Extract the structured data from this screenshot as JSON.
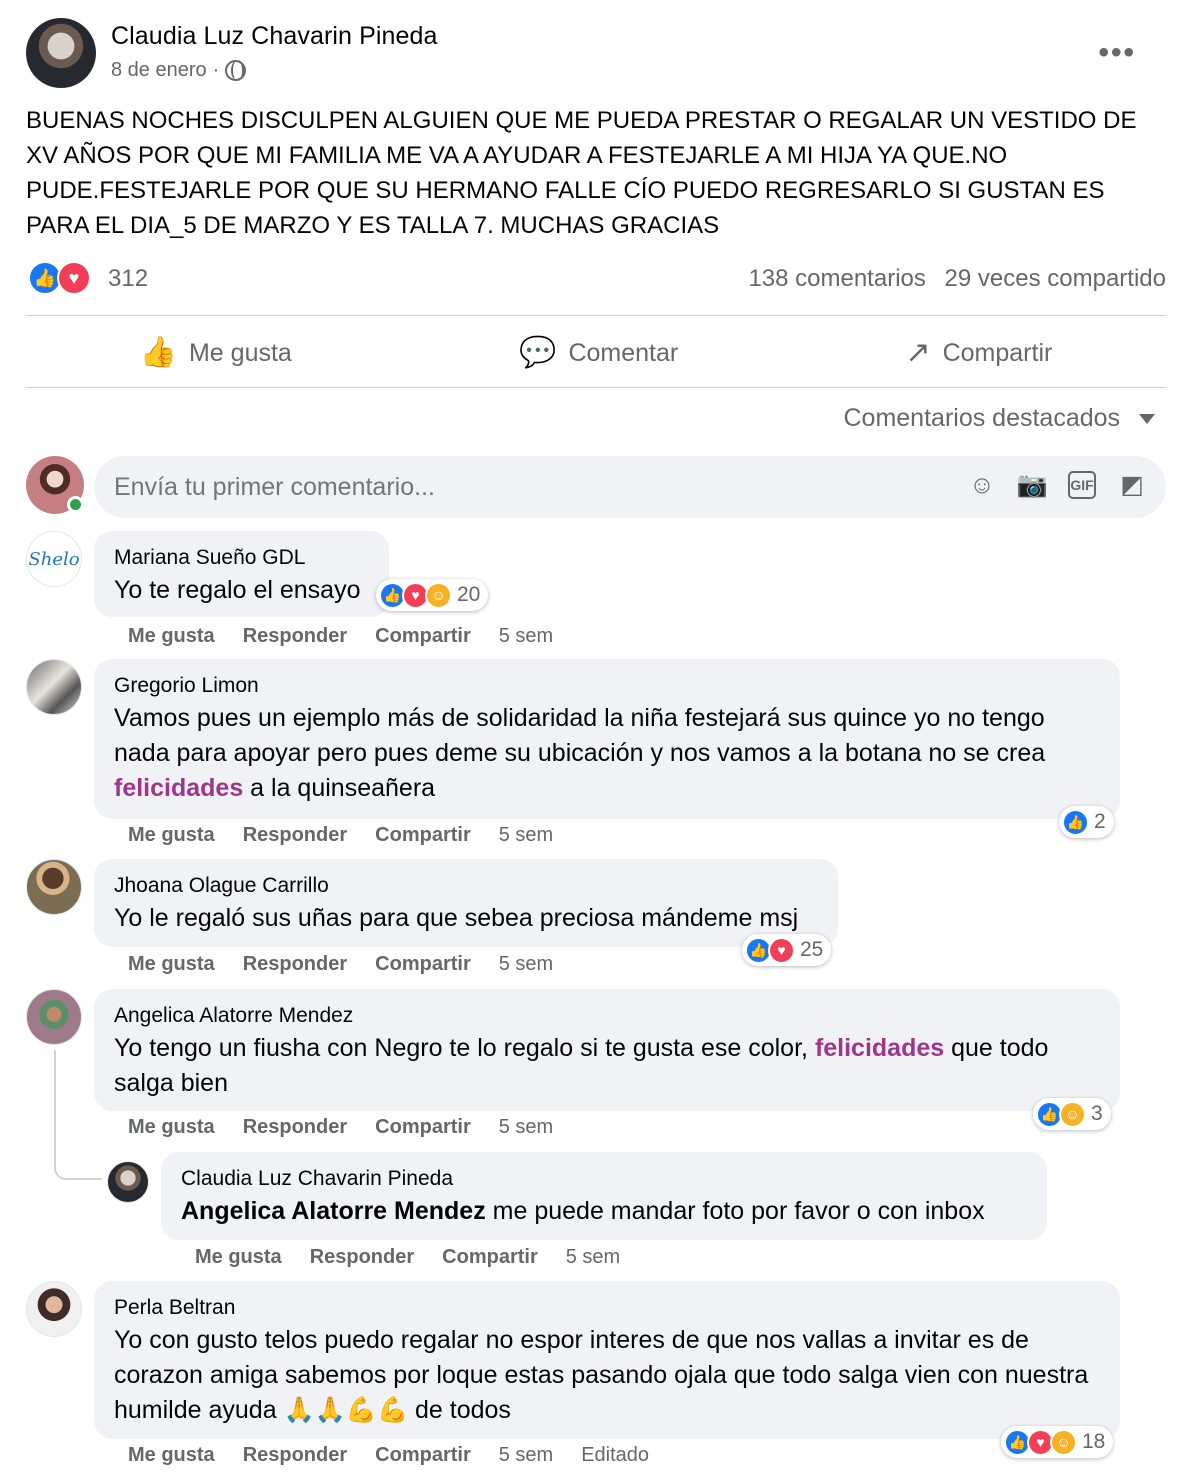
{
  "post": {
    "author": "Claudia Luz Chavarin Pineda",
    "date": "8 de enero",
    "separator": "·",
    "more_icon": "•••",
    "text": "BUENAS NOCHES DISCULPEN ALGUIEN QUE ME PUEDA PRESTAR O REGALAR UN VESTIDO DE XV AÑOS POR QUE MI FAMILIA ME VA A AYUDAR A FESTEJARLE A MI HIJA YA QUE.NO PUDE.FESTEJARLE POR QUE  SU HERMANO FALLE CÍO PUEDO REGRESARLO SI GUSTAN ES PARA EL DIA_5 DE MARZO Y ES TALLA 7. MUCHAS GRACIAS",
    "reaction_count": "312",
    "comments_count": "138 comentarios",
    "shares_count": "29 veces compartido"
  },
  "actions": {
    "like": "Me gusta",
    "comment": "Comentar",
    "share": "Compartir",
    "like_icon": "👍",
    "comment_icon": "💬",
    "share_icon": "↗"
  },
  "sort": {
    "label": "Comentarios destacados"
  },
  "composer": {
    "placeholder": "Envía tu primer comentario...",
    "emoji_icon": "☺",
    "camera_icon": "📷",
    "gif_icon": "GIF",
    "sticker_icon": "◩"
  },
  "comment_actions": {
    "like": "Me gusta",
    "reply": "Responder",
    "share": "Compartir"
  },
  "comments": [
    {
      "name": "Mariana Sueño GDL",
      "text": "Yo te regalo el ensayo",
      "reaction_count": "20",
      "time": "5 sem",
      "avatar_label": "Shelo"
    },
    {
      "name": "Gregorio Limon",
      "text_before": "Vamos pues un ejemplo más de solidaridad la niña festejará sus quince yo no tengo nada para apoyar pero pues deme su ubicación y nos vamos a la botana no se crea ",
      "highlight": "felicidades",
      "text_after": " a la quinseañera",
      "reaction_count": "2",
      "time": "5 sem"
    },
    {
      "name": "Jhoana Olague Carrillo",
      "text": "Yo le regaló sus uñas para que sebea preciosa mándeme msj",
      "reaction_count": "25",
      "time": "5 sem"
    },
    {
      "name": "Angelica Alatorre Mendez",
      "text_before": "Yo tengo un fiusha con Negro te lo regalo si te gusta ese color, ",
      "highlight": "felicidades",
      "text_after": " que todo salga bien",
      "reaction_count": "3",
      "time": "5 sem"
    },
    {
      "name": "Claudia Luz Chavarin Pineda",
      "mention": "Angelica Alatorre Mendez",
      "text_after": " me puede mandar foto por favor o con inbox",
      "time": "5 sem"
    },
    {
      "name": "Perla Beltran",
      "text": "Yo con gusto telos puedo regalar no espor interes de que nos vallas a invitar es de corazon amiga sabemos por loque estas pasando ojala que todo salga vien con nuestra humilde ayuda 🙏🙏💪💪 de todos",
      "reaction_count": "18",
      "time": "5 sem",
      "edited": "Editado"
    }
  ],
  "colors": {
    "facebook_blue": "#1877f2",
    "love_red": "#f33e58",
    "care_yellow": "#f7b125",
    "mention_magenta": "#a0358d",
    "muted_text": "#65676b",
    "bubble_gray": "#f0f2f5"
  }
}
